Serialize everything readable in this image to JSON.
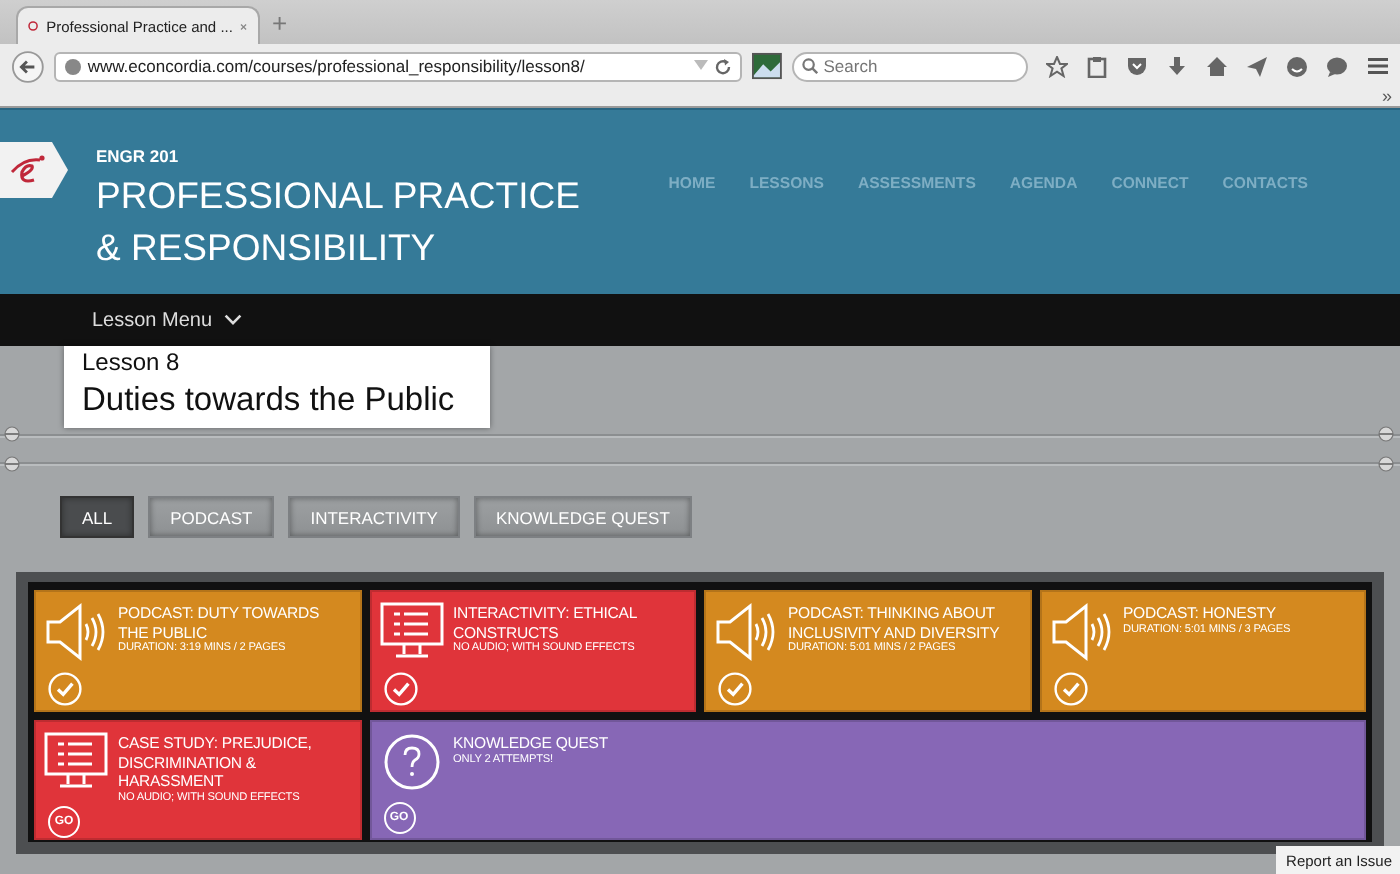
{
  "browser": {
    "tab_title": "Professional Practice and ...",
    "new_tab": "+",
    "url": "www.econcordia.com/courses/professional_responsibility/lesson8/",
    "search_placeholder": "Search",
    "overflow": "»"
  },
  "header": {
    "course_code": "ENGR 201",
    "title_lines": [
      "PROFESSIONAL PRACTICE",
      "& RESPONSIBILITY"
    ],
    "nav": [
      "HOME",
      "LESSONS",
      "ASSESSMENTS",
      "AGENDA",
      "CONNECT",
      "CONTACTS"
    ]
  },
  "lesson_menu": "Lesson Menu",
  "lesson": {
    "label": "Lesson 8",
    "title": "Duties towards the Public"
  },
  "filters": [
    {
      "label": "ALL",
      "selected": true
    },
    {
      "label": "PODCAST",
      "selected": false
    },
    {
      "label": "INTERACTIVITY",
      "selected": false
    },
    {
      "label": "KNOWLEDGE QUEST",
      "selected": false
    }
  ],
  "tiles": [
    {
      "kind": "podcast",
      "title": "PODCAST: DUTY TOWARDS THE PUBLIC",
      "detail": "DURATION: 3:19 MINS / 2 PAGES",
      "completed": true
    },
    {
      "kind": "interactivity",
      "title": "INTERACTIVITY: ETHICAL CONSTRUCTS",
      "detail": "NO AUDIO; WITH SOUND EFFECTS",
      "completed": true
    },
    {
      "kind": "podcast",
      "title": "PODCAST: THINKING ABOUT INCLUSIVITY AND DIVERSITY",
      "detail": "DURATION: 5:01 MINS / 2 PAGES",
      "completed": true
    },
    {
      "kind": "podcast",
      "title": "PODCAST: HONESTY",
      "detail": "DURATION: 5:01 MINS / 3 PAGES",
      "completed": true
    },
    {
      "kind": "interactivity",
      "title": "CASE STUDY: PREJUDICE, DISCRIMINATION & HARASSMENT",
      "detail": "NO AUDIO; WITH SOUND EFFECTS",
      "completed": false,
      "go_label": "GO"
    },
    {
      "kind": "quest",
      "title": "KNOWLEDGE QUEST",
      "detail": "ONLY 2 ATTEMPTS!",
      "completed": false,
      "go_label": "GO"
    }
  ],
  "report_link": "Report an Issue"
}
